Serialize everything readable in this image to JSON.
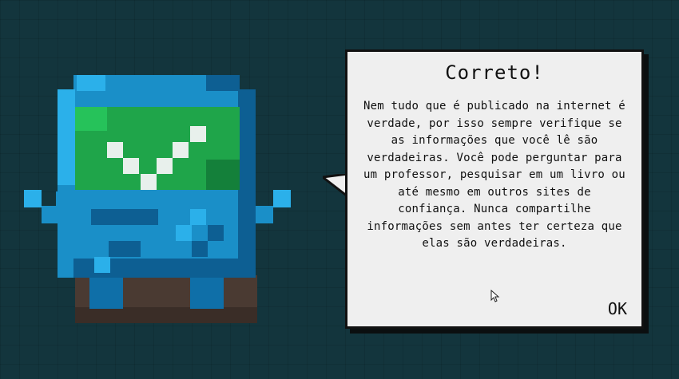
{
  "dialog": {
    "title": "Correto!",
    "message": "Nem tudo que é publicado na internet é verdade, por isso sempre verifique se as informações que você lê são verdadeiras. Você pode perguntar para um professor, pesquisar em um livro ou até mesmo em outros sites de confiança. Nunca compartilhe informações sem antes ter certeza que elas são verdadeiras.",
    "ok_label": "OK"
  },
  "character": {
    "name": "robot-checkmark",
    "colors": {
      "body": "#1a8fc8",
      "body_light": "#2bb0ea",
      "body_dark": "#0d5f93",
      "screen": "#1fa54a",
      "screen_dark": "#14803a",
      "check": "#e8f0ec",
      "shadow": "#4a3a32"
    }
  },
  "background": {
    "color": "#13353d"
  },
  "icons": [
    "robot-icon",
    "checkmark-icon",
    "speech-tail-icon",
    "mouse-cursor-icon"
  ]
}
